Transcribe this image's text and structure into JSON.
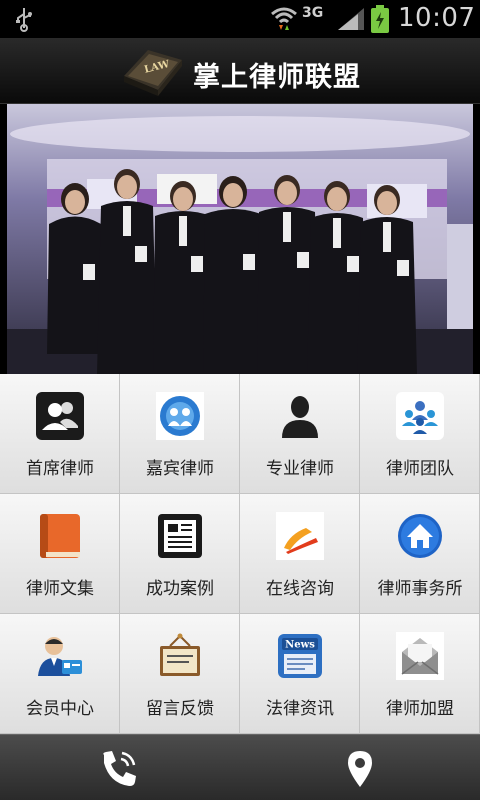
{
  "status_bar": {
    "network_type": "3G",
    "time": "10:07"
  },
  "header": {
    "title": "掌上律师联盟",
    "logo_text": "LAW"
  },
  "banner": {
    "description_icon": "photo-of-lawyers-group",
    "slide_count": 2,
    "active_slide": 1
  },
  "menu": {
    "items": [
      {
        "label": "首席律师",
        "icon": "contacts-icon"
      },
      {
        "label": "嘉宾律师",
        "icon": "guest-people-icon"
      },
      {
        "label": "专业律师",
        "icon": "person-silhouette-icon"
      },
      {
        "label": "律师团队",
        "icon": "team-icon"
      },
      {
        "label": "律师文集",
        "icon": "book-icon"
      },
      {
        "label": "成功案例",
        "icon": "document-frame-icon"
      },
      {
        "label": "在线咨询",
        "icon": "chat-pen-icon"
      },
      {
        "label": "律师事务所",
        "icon": "home-icon"
      },
      {
        "label": "会员中心",
        "icon": "member-card-icon"
      },
      {
        "label": "留言反馈",
        "icon": "message-board-icon"
      },
      {
        "label": "法律资讯",
        "icon": "news-icon"
      },
      {
        "label": "律师加盟",
        "icon": "envelope-join-icon"
      }
    ]
  },
  "bottom_bar": {
    "call_icon": "phone-icon",
    "location_icon": "map-pin-icon"
  },
  "colors": {
    "header_bg": "#111111",
    "grid_bg": "#eeeeee",
    "battery_green": "#7ac943",
    "home_blue": "#1e63c6"
  }
}
